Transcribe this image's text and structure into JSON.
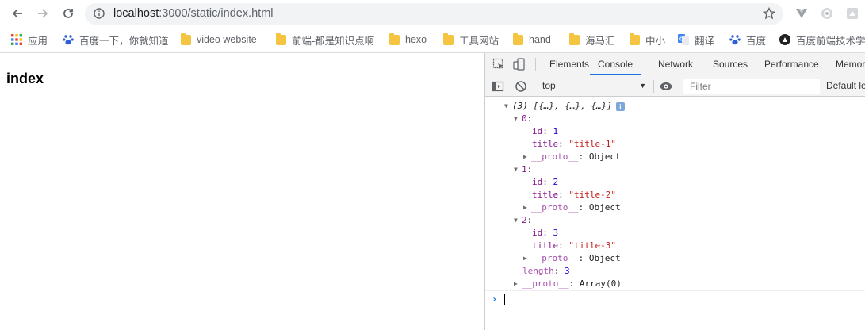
{
  "browser": {
    "url_host": "localhost",
    "url_rest": ":3000/static/index.html",
    "bookmarks": [
      {
        "label": "应用",
        "icon": "apps-grid-icon"
      },
      {
        "label": "百度一下，你就知道",
        "icon": "baidu-paw-icon"
      },
      {
        "label": "video website",
        "icon": "folder-icon"
      },
      {
        "label": "前端-都是知识点啊",
        "icon": "folder-icon"
      },
      {
        "label": "hexo",
        "icon": "folder-icon"
      },
      {
        "label": "工具网站",
        "icon": "folder-icon"
      },
      {
        "label": "hand",
        "icon": "folder-icon"
      },
      {
        "label": "海马汇",
        "icon": "folder-icon"
      },
      {
        "label": "中小",
        "icon": "folder-icon"
      },
      {
        "label": "翻译",
        "icon": "google-translate-icon"
      },
      {
        "label": "百度",
        "icon": "baidu-paw-icon"
      },
      {
        "label": "百度前端技术学",
        "icon": "baidu-fe-logo-icon"
      }
    ]
  },
  "page": {
    "heading": "index"
  },
  "devtools": {
    "tabs": [
      {
        "label": "Elements",
        "active": false
      },
      {
        "label": "Console",
        "active": true
      },
      {
        "label": "Network",
        "active": false
      },
      {
        "label": "Sources",
        "active": false
      },
      {
        "label": "Performance",
        "active": false
      },
      {
        "label": "Memor",
        "active": false
      }
    ],
    "context": "top",
    "filter_placeholder": "Filter",
    "levels_label": "Default le",
    "accent_color": "#1a73e8"
  },
  "console": {
    "summary": "(3) [{…}, {…}, {…}]",
    "info_badge": "i",
    "items": [
      {
        "index": "0",
        "id_key": "id",
        "id_val": "1",
        "title_key": "title",
        "title_val": "\"title-1\"",
        "proto_key": "__proto__",
        "proto_val": "Object"
      },
      {
        "index": "1",
        "id_key": "id",
        "id_val": "2",
        "title_key": "title",
        "title_val": "\"title-2\"",
        "proto_key": "__proto__",
        "proto_val": "Object"
      },
      {
        "index": "2",
        "id_key": "id",
        "id_val": "3",
        "title_key": "title",
        "title_val": "\"title-3\"",
        "proto_key": "__proto__",
        "proto_val": "Object"
      }
    ],
    "length_key": "length",
    "length_val": "3",
    "array_proto_key": "__proto__",
    "array_proto_val": "Array(0)"
  }
}
